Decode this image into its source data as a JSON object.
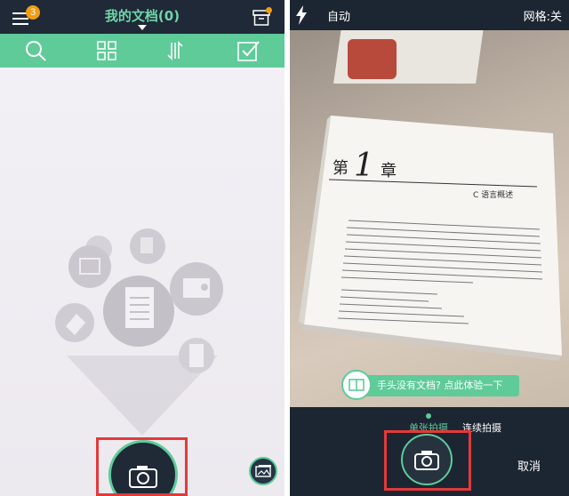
{
  "left": {
    "header": {
      "badge_count": "3",
      "title": "我的文档(0)"
    },
    "toolbar": {
      "icons": [
        "search-icon",
        "grid-icon",
        "sort-icon",
        "check-icon"
      ]
    }
  },
  "right": {
    "header": {
      "flash_mode": "自动",
      "grid_label": "网格:关"
    },
    "tip": {
      "text": "手头没有文档? 点此体验一下"
    },
    "modes": {
      "single": "单张拍摄",
      "continuous": "连续拍摄"
    },
    "cancel_label": "取消",
    "book": {
      "chapter_char1": "第",
      "chapter_num": "1",
      "chapter_char2": "章",
      "chapter_title": "C 语言概述"
    }
  },
  "colors": {
    "accent": "#5ecb99",
    "dark": "#1f2937",
    "badge": "#f39c12",
    "highlight": "#e23a3a"
  }
}
